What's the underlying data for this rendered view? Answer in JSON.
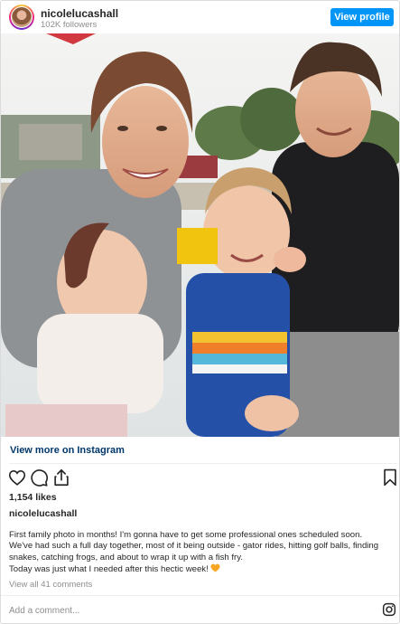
{
  "header": {
    "username": "nicolelucashall",
    "followers": "102K followers",
    "view_profile_label": "View profile"
  },
  "photo": {
    "description_icon": "family-photo"
  },
  "links": {
    "view_more": "View more on Instagram"
  },
  "post": {
    "likes": "1,154 likes",
    "caption_user": "nicolelucashall",
    "caption_line1": "First family photo in months! I'm gonna have to get some professional ones scheduled soon.",
    "caption_line2": "We've had such a full day together, most of it being outside - gator rides, hitting golf balls, finding",
    "caption_line3": "snakes, catching frogs, and about to wrap it up with a fish fry.",
    "caption_line4": "Today was just what I needed after this hectic week!",
    "view_all_comments": "View all 41 comments"
  },
  "comment": {
    "placeholder": "Add a comment..."
  },
  "icons": {
    "like": "heart-icon",
    "comment": "comment-bubble-icon",
    "share": "share-icon",
    "save": "bookmark-icon",
    "logo": "instagram-icon",
    "emoji": "orange-heart-emoji"
  },
  "colors": {
    "accent": "#0095f6",
    "link": "#00376b",
    "muted": "#8e8e8e",
    "emoji_heart": "#f6a623"
  }
}
